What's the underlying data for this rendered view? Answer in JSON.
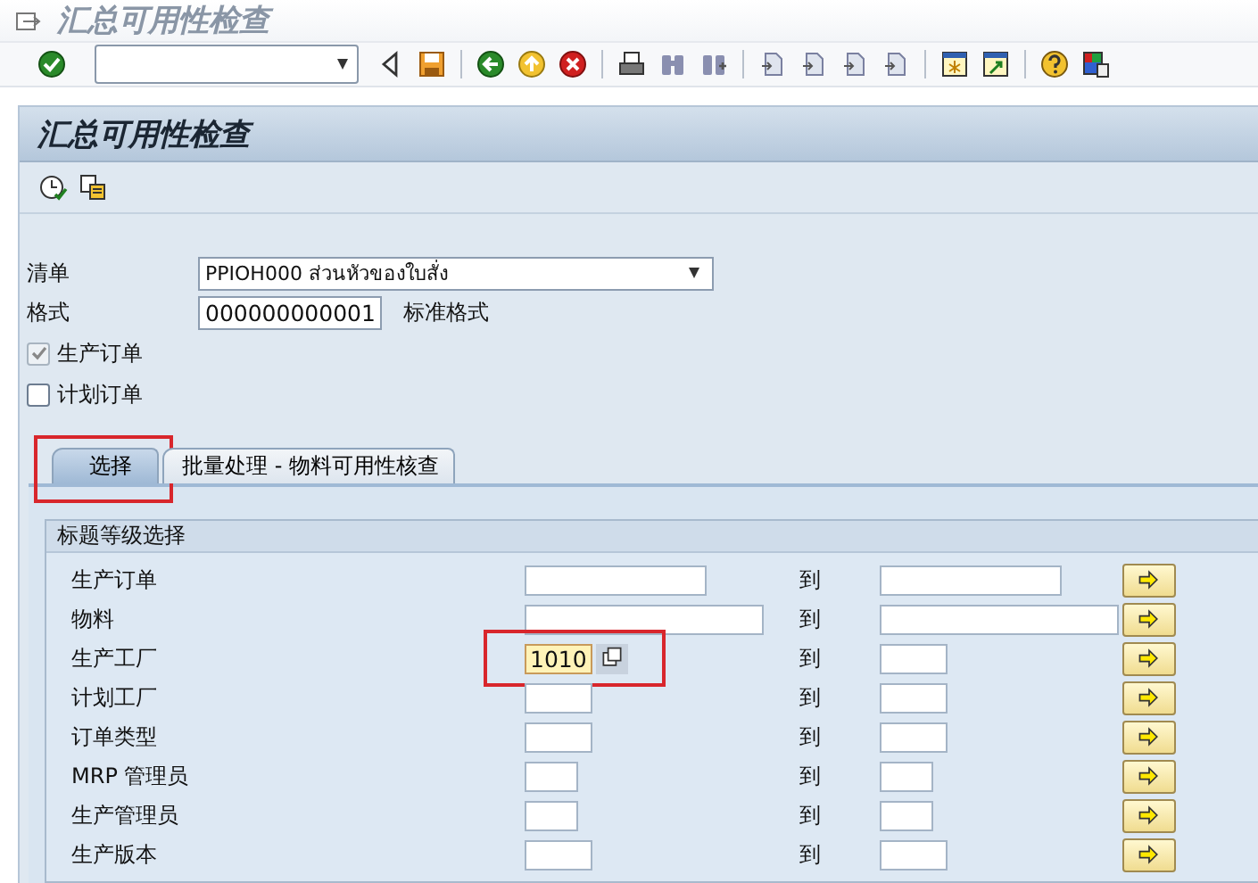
{
  "window": {
    "title": "汇总可用性检查"
  },
  "screen": {
    "title": "汇总可用性检查"
  },
  "fields": [
    {
      "label": "清单",
      "kind": "dropdown",
      "value": "PPIOH000 ส่วนหัวของใบสั่ง"
    },
    {
      "label": "格式",
      "kind": "text",
      "value": "000000000001",
      "description": "标准格式"
    }
  ],
  "checkboxes": [
    {
      "label": "生产订单",
      "checked": true,
      "disabled": true
    },
    {
      "label": "计划订单",
      "checked": false,
      "disabled": false
    }
  ],
  "tabs": [
    {
      "label": "选择",
      "selected": true,
      "highlighted": true
    },
    {
      "label": "批量处理 - 物料可用性核查",
      "selected": false,
      "highlighted": false
    }
  ],
  "group": {
    "title": "标题等级选择",
    "rows": [
      {
        "label": "生产订单",
        "to_label": "到",
        "focused": false,
        "highlighted": false
      },
      {
        "label": "物料",
        "to_label": "到",
        "focused": false,
        "highlighted": false
      },
      {
        "label": "生产工厂",
        "from": "1010",
        "to_label": "到",
        "focused": true,
        "highlighted": true
      },
      {
        "label": "计划工厂",
        "to_label": "到",
        "focused": false,
        "highlighted": false
      },
      {
        "label": "订单类型",
        "to_label": "到",
        "focused": false,
        "highlighted": false
      },
      {
        "label": "MRP 管理员",
        "to_label": "到",
        "focused": false,
        "highlighted": false
      },
      {
        "label": "生产管理员",
        "to_label": "到",
        "focused": false,
        "highlighted": false
      },
      {
        "label": "生产版本",
        "to_label": "到",
        "focused": false,
        "highlighted": false
      }
    ]
  }
}
